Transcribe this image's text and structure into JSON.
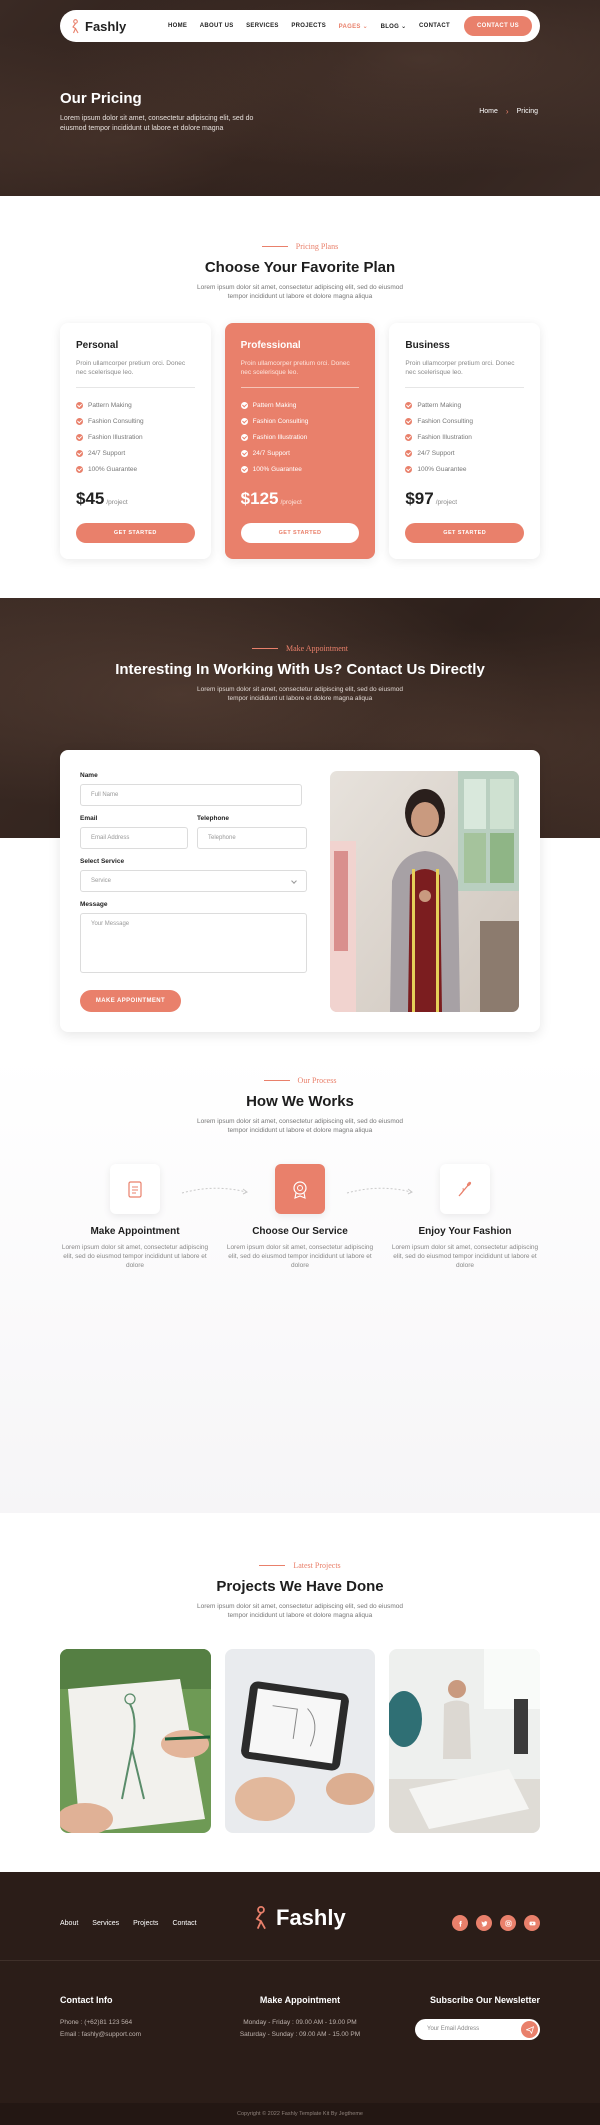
{
  "brand": {
    "name": "Fashly",
    "accent": "#e9806b",
    "dark": "#2b1d18"
  },
  "nav": {
    "items": [
      "HOME",
      "ABOUT US",
      "SERVICES",
      "PROJECTS",
      "PAGES",
      "BLOG",
      "CONTACT"
    ],
    "active_index": 4,
    "cta": "CONTACT US"
  },
  "hero": {
    "title": "Our Pricing",
    "subtitle": "Lorem ipsum dolor sit amet, consectetur adipiscing elit, sed do eiusmod tempor incididunt ut labore et dolore magna",
    "breadcrumb": [
      "Home",
      "Pricing"
    ]
  },
  "pricing": {
    "eyebrow": "Pricing Plans",
    "title": "Choose Your Favorite Plan",
    "desc": "Lorem ipsum dolor sit amet, consectetur adipiscing elit, sed do eiusmod tempor incididunt ut labore et dolore magna aliqua",
    "plans": [
      {
        "name": "Personal",
        "desc": "Proin ullamcorper pretium orci. Donec nec scelerisque leo.",
        "features": [
          "Pattern Making",
          "Fashion Consulting",
          "Fashion Illustration",
          "24/7 Support",
          "100% Guarantee"
        ],
        "price": "$45",
        "per": "/project",
        "button": "GET STARTED"
      },
      {
        "name": "Professional",
        "desc": "Proin ullamcorper pretium orci. Donec nec scelerisque leo.",
        "features": [
          "Pattern Making",
          "Fashion Consulting",
          "Fashion Illustration",
          "24/7 Support",
          "100% Guarantee"
        ],
        "price": "$125",
        "per": "/project",
        "button": "GET STARTED"
      },
      {
        "name": "Business",
        "desc": "Proin ullamcorper pretium orci. Donec nec scelerisque leo.",
        "features": [
          "Pattern Making",
          "Fashion Consulting",
          "Fashion Illustration",
          "24/7 Support",
          "100% Guarantee"
        ],
        "price": "$97",
        "per": "/project",
        "button": "GET STARTED"
      }
    ]
  },
  "appointment": {
    "eyebrow": "Make Appointment",
    "title": "Interesting In Working With Us? Contact Us Directly",
    "desc": "Lorem ipsum dolor sit amet, consectetur adipiscing elit, sed do eiusmod tempor incididunt ut labore et dolore magna aliqua",
    "form": {
      "name_label": "Name",
      "name_placeholder": "Full Name",
      "email_label": "Email",
      "email_placeholder": "Email Address",
      "phone_label": "Telephone",
      "phone_placeholder": "Telephone",
      "service_label": "Select Service",
      "service_value": "Service",
      "message_label": "Message",
      "message_placeholder": "Your Message",
      "submit": "MAKE APPOINTMENT"
    }
  },
  "process": {
    "eyebrow": "Our Process",
    "title": "How We Works",
    "desc": "Lorem ipsum dolor sit amet, consectetur adipiscing elit, sed do eiusmod tempor incididunt ut labore et dolore magna aliqua",
    "steps": [
      {
        "title": "Make Appointment",
        "desc": "Lorem ipsum dolor sit amet, consectetur adipiscing elit, sed do eiusmod tempor incididunt ut labore et dolore",
        "icon": "calendar-icon"
      },
      {
        "title": "Choose Our Service",
        "desc": "Lorem ipsum dolor sit amet, consectetur adipiscing elit, sed do eiusmod tempor incididunt ut labore et dolore",
        "icon": "badge-icon"
      },
      {
        "title": "Enjoy Your Fashion",
        "desc": "Lorem ipsum dolor sit amet, consectetur adipiscing elit, sed do eiusmod tempor incididunt ut labore et dolore",
        "icon": "needle-icon"
      }
    ]
  },
  "projects": {
    "eyebrow": "Latest Projects",
    "title": "Projects We Have Done",
    "desc": "Lorem ipsum dolor sit amet, consectetur adipiscing elit, sed do eiusmod tempor incididunt ut labore et dolore magna aliqua"
  },
  "footer": {
    "links": [
      "About",
      "Services",
      "Projects",
      "Contact"
    ],
    "contact_title": "Contact Info",
    "phone": "Phone : (+62)81 123 564",
    "email": "Email : fashly@support.com",
    "hours_title": "Make Appointment",
    "hours": [
      "Monday - Friday : 09.00 AM - 19.00 PM",
      "Saturday - Sunday : 09.00 AM - 15.00 PM"
    ],
    "newsletter_title": "Subscribe Our Newsletter",
    "newsletter_placeholder": "Your Email Address",
    "copyright": "Copyright © 2022 Fashly Template Kit By Jegtheme",
    "socials": [
      "facebook-icon",
      "twitter-icon",
      "instagram-icon",
      "youtube-icon"
    ]
  }
}
